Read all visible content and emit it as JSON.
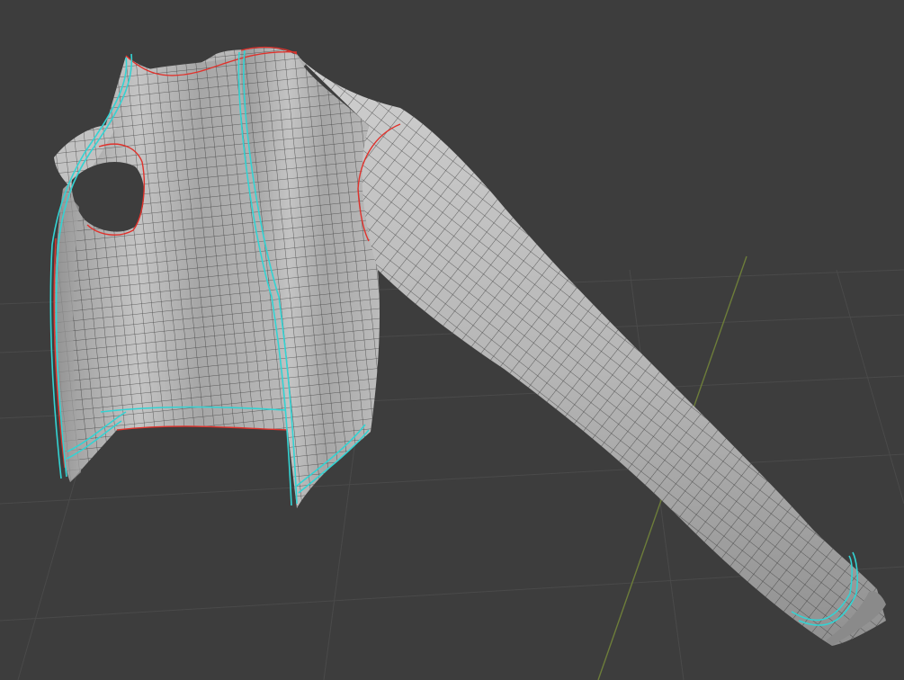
{
  "viewport": {
    "background_color": "#3d3d3d",
    "grid_color": "#4a4a4a",
    "y_axis_color": "#6d7d3a"
  },
  "mesh": {
    "object": "jacket",
    "parts": [
      "body-left-panel",
      "body-right-panel",
      "back-panel",
      "sleeve"
    ],
    "surface_color": "#b4b4b4",
    "wire_color": "#2e2e2e",
    "seam_color": "#e0322c",
    "selected_edge_color": "#33d3d3"
  }
}
